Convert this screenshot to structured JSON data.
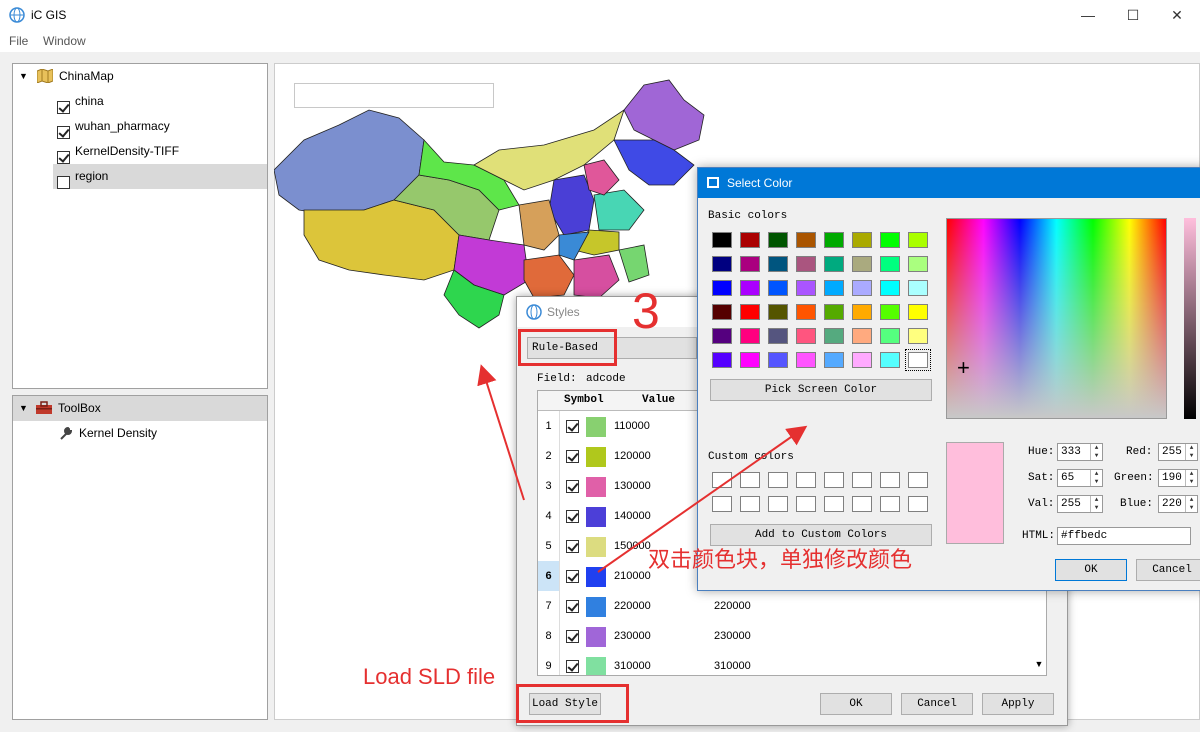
{
  "app": {
    "title": "iC GIS",
    "menu": [
      "File",
      "Window"
    ],
    "window_controls": {
      "minimize": "—",
      "maximize": "☐",
      "close": "✕"
    }
  },
  "layers": {
    "group": "ChinaMap",
    "items": [
      {
        "label": "china",
        "checked": true
      },
      {
        "label": "wuhan_pharmacy",
        "checked": true
      },
      {
        "label": "KernelDensity-TIFF",
        "checked": true
      },
      {
        "label": "region",
        "checked": false
      }
    ]
  },
  "toolbox": {
    "group": "ToolBox",
    "items": [
      {
        "label": "Kernel Density"
      }
    ]
  },
  "map": {
    "search_value": "",
    "region_colors": [
      "#7b8fcf",
      "#dcc53a",
      "#96c86c",
      "#5ee64a",
      "#c23ad6",
      "#2ed64e",
      "#e0e078",
      "#a066d6",
      "#3f4ae6",
      "#d6a05a",
      "#4a3fd6",
      "#48d6b4",
      "#e06a3a",
      "#d64fa0",
      "#76d670",
      "#c6c62a",
      "#e0579a",
      "#3a8ad6"
    ]
  },
  "styles_dialog": {
    "title": "Styles",
    "mode_button": "Rule-Based",
    "field_label": "Field:",
    "field_value": "adcode",
    "columns": [
      "Symbol",
      "Value"
    ],
    "rows": [
      {
        "n": "1",
        "color": "#88d070",
        "value": "110000",
        "label": ""
      },
      {
        "n": "2",
        "color": "#b0c81c",
        "value": "120000",
        "label": ""
      },
      {
        "n": "3",
        "color": "#e060a8",
        "value": "130000",
        "label": ""
      },
      {
        "n": "4",
        "color": "#4c3fd8",
        "value": "140000",
        "label": ""
      },
      {
        "n": "5",
        "color": "#dcdc80",
        "value": "150000",
        "label": ""
      },
      {
        "n": "6",
        "color": "#2040f0",
        "value": "210000",
        "label": ""
      },
      {
        "n": "7",
        "color": "#3080e0",
        "value": "220000",
        "label": "220000"
      },
      {
        "n": "8",
        "color": "#a066d8",
        "value": "230000",
        "label": "230000"
      },
      {
        "n": "9",
        "color": "#80e0a0",
        "value": "310000",
        "label": "310000"
      }
    ],
    "load_button": "Load Style",
    "ok_button": "OK",
    "cancel_button": "Cancel",
    "apply_button": "Apply"
  },
  "color_dialog": {
    "title": "Select Color",
    "basic_label": "Basic colors",
    "basic_colors": [
      "#000000",
      "#aa0000",
      "#005500",
      "#aa5500",
      "#00aa00",
      "#aaaa00",
      "#00ff00",
      "#aaff00",
      "#000080",
      "#aa007f",
      "#00557f",
      "#aa557f",
      "#00aa7f",
      "#aaaa7f",
      "#00ff7f",
      "#aaff7f",
      "#0000ff",
      "#aa00ff",
      "#0055ff",
      "#aa55ff",
      "#00aaff",
      "#aaaaff",
      "#00ffff",
      "#aaffff",
      "#550000",
      "#ff0000",
      "#555500",
      "#ff5500",
      "#55aa00",
      "#ffaa00",
      "#55ff00",
      "#ffff00",
      "#55007f",
      "#ff007f",
      "#55557f",
      "#ff557f",
      "#55aa7f",
      "#ffaa7f",
      "#55ff7f",
      "#ffff7f",
      "#5500ff",
      "#ff00ff",
      "#5555ff",
      "#ff55ff",
      "#55aaff",
      "#ffaaff",
      "#55ffff",
      "#ffffff"
    ],
    "pick_screen_button": "Pick Screen Color",
    "custom_label": "Custom colors",
    "add_custom_button": "Add to Custom Colors",
    "preview_color": "#ffbedc",
    "fields": {
      "hue_label": "Hue:",
      "hue": "333",
      "sat_label": "Sat:",
      "sat": "65",
      "val_label": "Val:",
      "val": "255",
      "red_label": "Red:",
      "red": "255",
      "green_label": "Green:",
      "green": "190",
      "blue_label": "Blue:",
      "blue": "220",
      "html_label": "HTML:",
      "html": "#ffbedc"
    },
    "ok_button": "OK",
    "cancel_button": "Cancel"
  },
  "annotations": {
    "step_number": "3",
    "double_click_note": "双击颜色块，单独修改颜色",
    "load_sld_note": "Load SLD file"
  }
}
